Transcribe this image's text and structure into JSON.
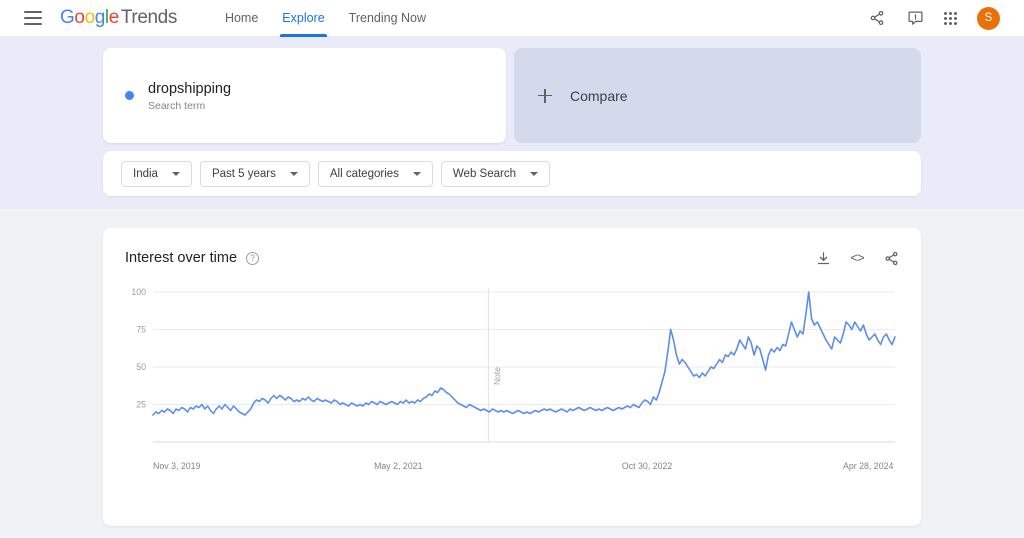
{
  "header": {
    "menu_icon": "hamburger-menu-icon",
    "brand": {
      "google": "Google",
      "product": "Trends"
    },
    "nav": [
      {
        "label": "Home",
        "active": false
      },
      {
        "label": "Explore",
        "active": true
      },
      {
        "label": "Trending Now",
        "active": false
      }
    ],
    "share_icon": "share-icon",
    "feedback_icon": "feedback-icon",
    "apps_icon": "apps-grid-icon",
    "avatar_initial": "S",
    "avatar_color": "#e8710a"
  },
  "search_term": {
    "name": "dropshipping",
    "type": "Search term",
    "dot_color": "#4285f4"
  },
  "compare": {
    "label": "Compare",
    "plus_icon": "plus-icon"
  },
  "filters": [
    {
      "label": "India"
    },
    {
      "label": "Past 5 years"
    },
    {
      "label": "All categories"
    },
    {
      "label": "Web Search"
    }
  ],
  "chart_card": {
    "title": "Interest over time",
    "help_icon": "help-question-icon",
    "download_icon": "download-icon",
    "embed_icon": "embed-code-icon",
    "embed_glyph": "<>",
    "share_icon": "share-icon",
    "note_label": "Note"
  },
  "chart_data": {
    "type": "line",
    "title": "Interest over time",
    "xlabel": "",
    "ylabel": "",
    "ylim": [
      0,
      100
    ],
    "yticks": [
      25,
      50,
      75,
      100
    ],
    "grid": true,
    "legend": false,
    "line_color": "#5b8def",
    "tick_labels": [
      "Nov 3, 2019",
      "May 2, 2021",
      "Oct 30, 2022",
      "Apr 28, 2024"
    ],
    "tick_positions": [
      0,
      0.333,
      0.667,
      1.0
    ],
    "annotations": [
      {
        "label": "Note",
        "x_fraction": 0.452
      }
    ],
    "series": [
      {
        "name": "dropshipping",
        "values": [
          18,
          20,
          19,
          21,
          20,
          22,
          21,
          19,
          22,
          21,
          23,
          22,
          20,
          23,
          22,
          24,
          23,
          25,
          22,
          24,
          21,
          19,
          22,
          24,
          22,
          25,
          23,
          21,
          24,
          22,
          20,
          19,
          18,
          20,
          22,
          26,
          28,
          27,
          29,
          28,
          26,
          29,
          31,
          29,
          31,
          30,
          28,
          30,
          29,
          27,
          28,
          27,
          29,
          28,
          30,
          28,
          27,
          29,
          28,
          27,
          28,
          27,
          26,
          28,
          27,
          25,
          26,
          25,
          24,
          26,
          25,
          24,
          25,
          24,
          26,
          25,
          27,
          26,
          25,
          27,
          26,
          25,
          26,
          27,
          26,
          25,
          27,
          26,
          28,
          26,
          27,
          26,
          28,
          27,
          29,
          30,
          32,
          31,
          34,
          33,
          36,
          35,
          33,
          32,
          30,
          28,
          26,
          25,
          24,
          23,
          25,
          24,
          23,
          22,
          21,
          22,
          21,
          20,
          22,
          21,
          20,
          21,
          20,
          21,
          20,
          19,
          20,
          21,
          20,
          19,
          20,
          19,
          20,
          21,
          20,
          21,
          22,
          21,
          22,
          21,
          20,
          21,
          22,
          21,
          20,
          22,
          21,
          22,
          23,
          22,
          21,
          22,
          23,
          22,
          21,
          22,
          21,
          22,
          23,
          22,
          21,
          22,
          23,
          22,
          23,
          24,
          23,
          25,
          24,
          23,
          26,
          28,
          27,
          25,
          30,
          28,
          33,
          40,
          47,
          60,
          75,
          68,
          58,
          52,
          55,
          53,
          50,
          47,
          44,
          45,
          43,
          46,
          44,
          47,
          50,
          49,
          52,
          55,
          53,
          58,
          57,
          60,
          58,
          62,
          68,
          65,
          62,
          70,
          66,
          58,
          64,
          62,
          55,
          48,
          58,
          62,
          60,
          63,
          61,
          65,
          64,
          72,
          80,
          75,
          70,
          74,
          72,
          85,
          100,
          82,
          78,
          80,
          76,
          72,
          68,
          65,
          62,
          70,
          68,
          66,
          72,
          80,
          78,
          75,
          80,
          77,
          74,
          78,
          72,
          68,
          70,
          72,
          68,
          65,
          70,
          72,
          68,
          65,
          70
        ]
      }
    ]
  }
}
